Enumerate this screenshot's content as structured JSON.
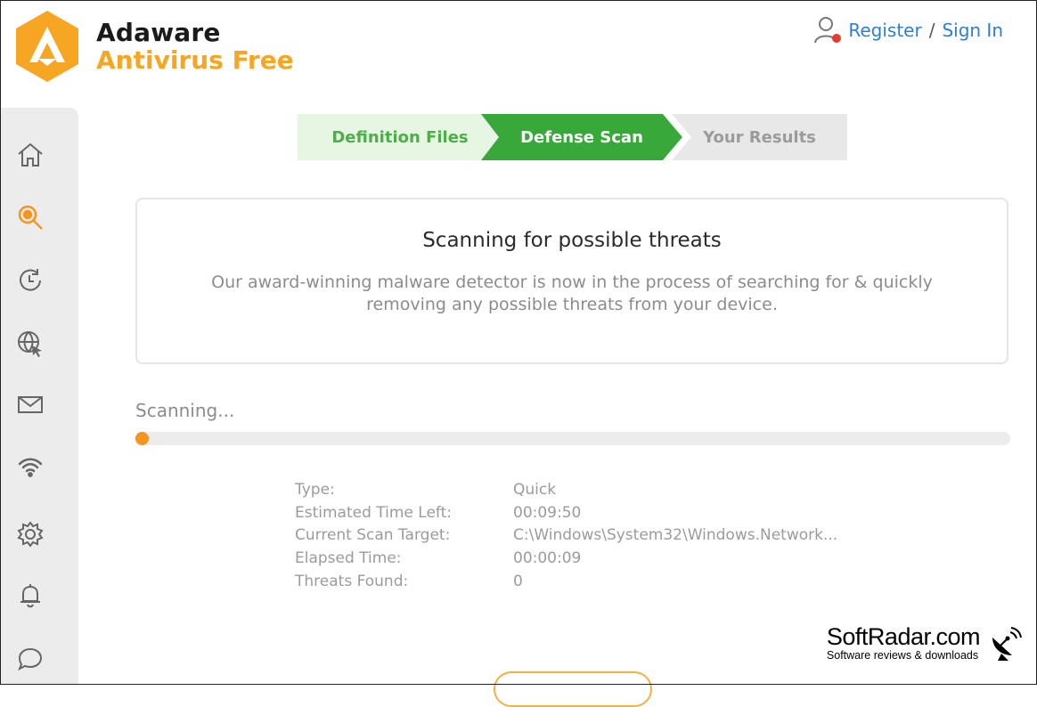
{
  "brand": {
    "name": "Adaware",
    "product": "Antivirus Free",
    "colors": {
      "orange": "#f6a623",
      "dark": "#1a1a1a"
    }
  },
  "account": {
    "register_label": "Register",
    "separator": "/",
    "signin_label": "Sign In"
  },
  "sidebar": {
    "items": [
      {
        "icon": "home-icon"
      },
      {
        "icon": "scan-icon",
        "active": true
      },
      {
        "icon": "history-icon"
      },
      {
        "icon": "web-protection-icon"
      },
      {
        "icon": "mail-icon"
      },
      {
        "icon": "wifi-icon"
      },
      {
        "icon": "settings-icon"
      },
      {
        "icon": "notifications-icon"
      },
      {
        "icon": "chat-icon"
      }
    ]
  },
  "steps": {
    "items": [
      {
        "label": "Definition Files",
        "state": "done"
      },
      {
        "label": "Defense Scan",
        "state": "active"
      },
      {
        "label": "Your Results",
        "state": "pending"
      }
    ],
    "colors": {
      "done_bg": "#e6f6e2",
      "active_bg": "#39a83a",
      "pending_bg": "#e8e8e8"
    }
  },
  "card": {
    "title": "Scanning for possible threats",
    "body": "Our award-winning malware detector is now in the process of searching for & quickly removing any possible threats from your device."
  },
  "progress": {
    "label": "Scanning...",
    "percent": 0
  },
  "details": {
    "rows": [
      {
        "key": "Type:",
        "value": "Quick"
      },
      {
        "key": "Estimated Time Left:",
        "value": "00:09:50"
      },
      {
        "key": "Current Scan Target:",
        "value": "C:\\Windows\\System32\\Windows.Network..."
      },
      {
        "key": "Elapsed Time:",
        "value": "00:00:09"
      },
      {
        "key": "Threats Found:",
        "value": "0"
      }
    ]
  },
  "watermark": {
    "title": "SoftRadar.com",
    "subtitle": "Software reviews & downloads"
  }
}
